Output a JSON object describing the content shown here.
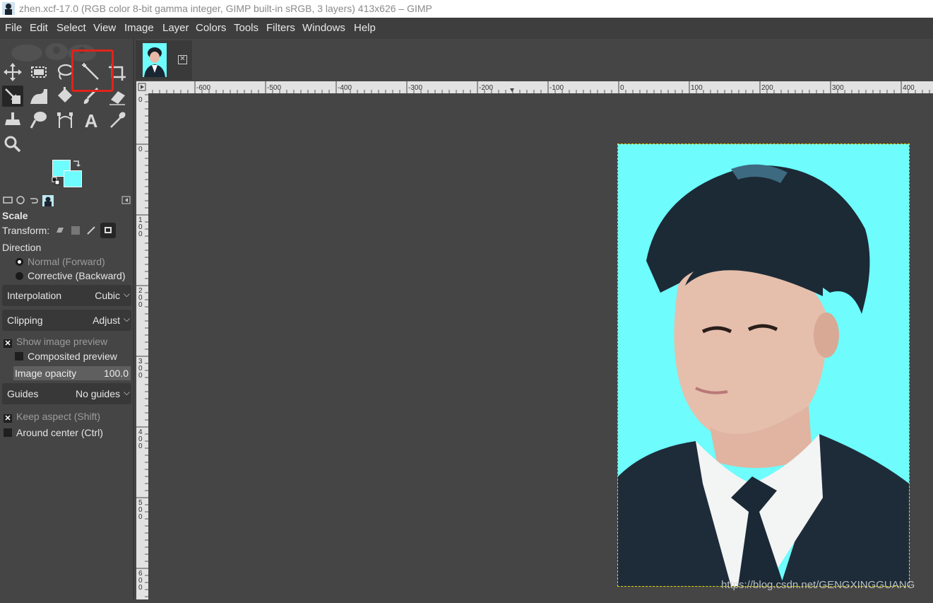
{
  "window": {
    "title": "zhen.xcf-17.0 (RGB color 8-bit gamma integer, GIMP built-in sRGB, 3 layers) 413x626 – GIMP"
  },
  "menu": [
    "File",
    "Edit",
    "Select",
    "View",
    "Image",
    "Layer",
    "Colors",
    "Tools",
    "Filters",
    "Windows",
    "Help"
  ],
  "toolbox": {
    "tools": [
      "move-tool",
      "rect-select-tool",
      "free-select-tool",
      "fuzzy-select-tool",
      "crop-tool",
      "scale-tool",
      "warp-tool",
      "bucket-fill-tool",
      "paintbrush-tool",
      "eraser-tool",
      "clone-tool",
      "smudge-tool",
      "paths-tool",
      "text-tool",
      "color-picker-tool",
      "zoom-tool"
    ],
    "active_tool": "scale-tool",
    "highlighted_tool": "fuzzy-select-tool",
    "fg_color": "#6ffcff",
    "bg_color": "#6ffcff"
  },
  "tool_options": {
    "title": "Scale",
    "transform_label": "Transform:",
    "direction_label": "Direction",
    "direction_normal": "Normal (Forward)",
    "direction_corrective": "Corrective (Backward)",
    "interpolation_label": "Interpolation",
    "interpolation_value": "Cubic",
    "clipping_label": "Clipping",
    "clipping_value": "Adjust",
    "show_preview_label": "Show image preview",
    "composited_preview_label": "Composited preview",
    "image_opacity_label": "Image opacity",
    "image_opacity_value": "100.0",
    "guides_label": "Guides",
    "guides_value": "No guides",
    "keep_aspect_label": "Keep aspect (Shift)",
    "around_center_label": "Around center (Ctrl)"
  },
  "rulers": {
    "horizontal": [
      "-600",
      "-500",
      "-400",
      "-300",
      "-200",
      "-100",
      "0",
      "100",
      "200",
      "300",
      "400"
    ],
    "vertical": [
      "0",
      "100",
      "200",
      "300",
      "400",
      "500",
      "600"
    ]
  },
  "watermark": "https://blog.csdn.net/GENGXINGGUANG"
}
